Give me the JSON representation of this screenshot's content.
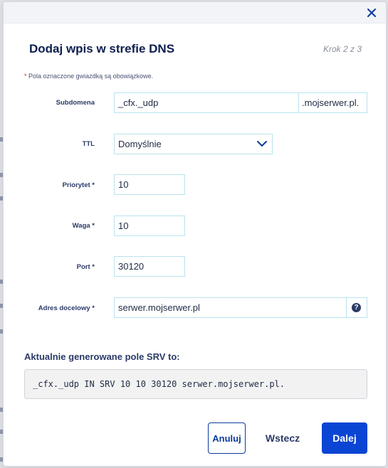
{
  "modal": {
    "title": "Dodaj wpis w strefie DNS",
    "step": "Krok 2 z 3",
    "required_note_star": "*",
    "required_note": "Pola oznaczone gwiazdką są obowiązkowe."
  },
  "fields": {
    "subdomain": {
      "label": "Subdomena",
      "value": "_cfx._udp",
      "suffix": ".mojserwer.pl."
    },
    "ttl": {
      "label": "TTL",
      "value": "Domyślnie"
    },
    "priority": {
      "label": "Priorytet *",
      "value": "10"
    },
    "weight": {
      "label": "Waga *",
      "value": "10"
    },
    "port": {
      "label": "Port *",
      "value": "30120"
    },
    "target": {
      "label": "Adres docelowy *",
      "value": "serwer.mojserwer.pl"
    }
  },
  "srv": {
    "heading": "Aktualnie generowane pole SRV to:",
    "record": "_cfx._udp IN SRV 10 10 30120 serwer.mojserwer.pl."
  },
  "buttons": {
    "cancel": "Anuluj",
    "back": "Wstecz",
    "next": "Dalej"
  },
  "colors": {
    "accent": "#0b45d4",
    "title": "#0e1f4f",
    "field_border": "#b9e3ef",
    "required_star": "#e0281c"
  },
  "icons": {
    "close": "close-icon",
    "select_caret": "chevron-down-icon",
    "help": "question-circle-icon"
  }
}
